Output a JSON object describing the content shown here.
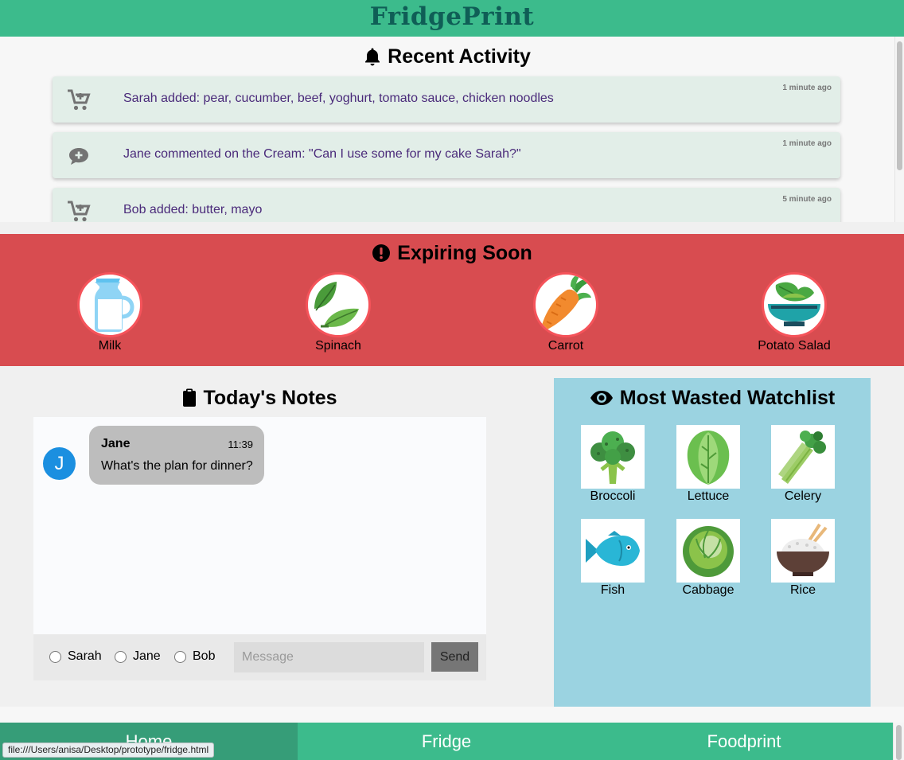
{
  "header": {
    "title": "FridgePrint"
  },
  "activity": {
    "heading": "Recent Activity",
    "items": [
      {
        "icon": "cart-plus-icon",
        "text": "Sarah added: pear, cucumber, beef, yoghurt, tomato sauce, chicken noodles",
        "time": "1 minute ago"
      },
      {
        "icon": "comment-plus-icon",
        "text": "Jane commented on the Cream: \"Can I use some for my cake Sarah?\"",
        "time": "1 minute ago"
      },
      {
        "icon": "cart-plus-icon",
        "text": "Bob added: butter, mayo",
        "time": "5 minute ago"
      }
    ]
  },
  "expiring": {
    "heading": "Expiring Soon",
    "items": [
      {
        "label": "Milk",
        "icon": "milk-jug-icon"
      },
      {
        "label": "Spinach",
        "icon": "spinach-icon"
      },
      {
        "label": "Carrot",
        "icon": "carrot-icon"
      },
      {
        "label": "Potato Salad",
        "icon": "salad-bowl-icon"
      }
    ]
  },
  "notes": {
    "heading": "Today's Notes",
    "messages": [
      {
        "avatar": "J",
        "name": "Jane",
        "time": "11:39",
        "text": "What's the plan for dinner?"
      }
    ],
    "recipients": [
      "Sarah",
      "Jane",
      "Bob"
    ],
    "placeholder": "Message",
    "send_label": "Send"
  },
  "watchlist": {
    "heading": "Most Wasted Watchlist",
    "items": [
      {
        "label": "Broccoli",
        "icon": "broccoli-icon"
      },
      {
        "label": "Lettuce",
        "icon": "lettuce-icon"
      },
      {
        "label": "Celery",
        "icon": "celery-icon"
      },
      {
        "label": "Fish",
        "icon": "fish-icon"
      },
      {
        "label": "Cabbage",
        "icon": "cabbage-icon"
      },
      {
        "label": "Rice",
        "icon": "rice-bowl-icon"
      }
    ]
  },
  "nav": {
    "tabs": [
      "Home",
      "Fridge",
      "Foodprint"
    ],
    "active": "Home"
  },
  "status": {
    "url": "file:///Users/anisa/Desktop/prototype/fridge.html"
  },
  "colors": {
    "header": "#3cbb8c",
    "expiring": "#d84c50",
    "watchlist": "#9bd3e1",
    "activity_text": "#4a2a7a",
    "title": "#0f5e56"
  }
}
